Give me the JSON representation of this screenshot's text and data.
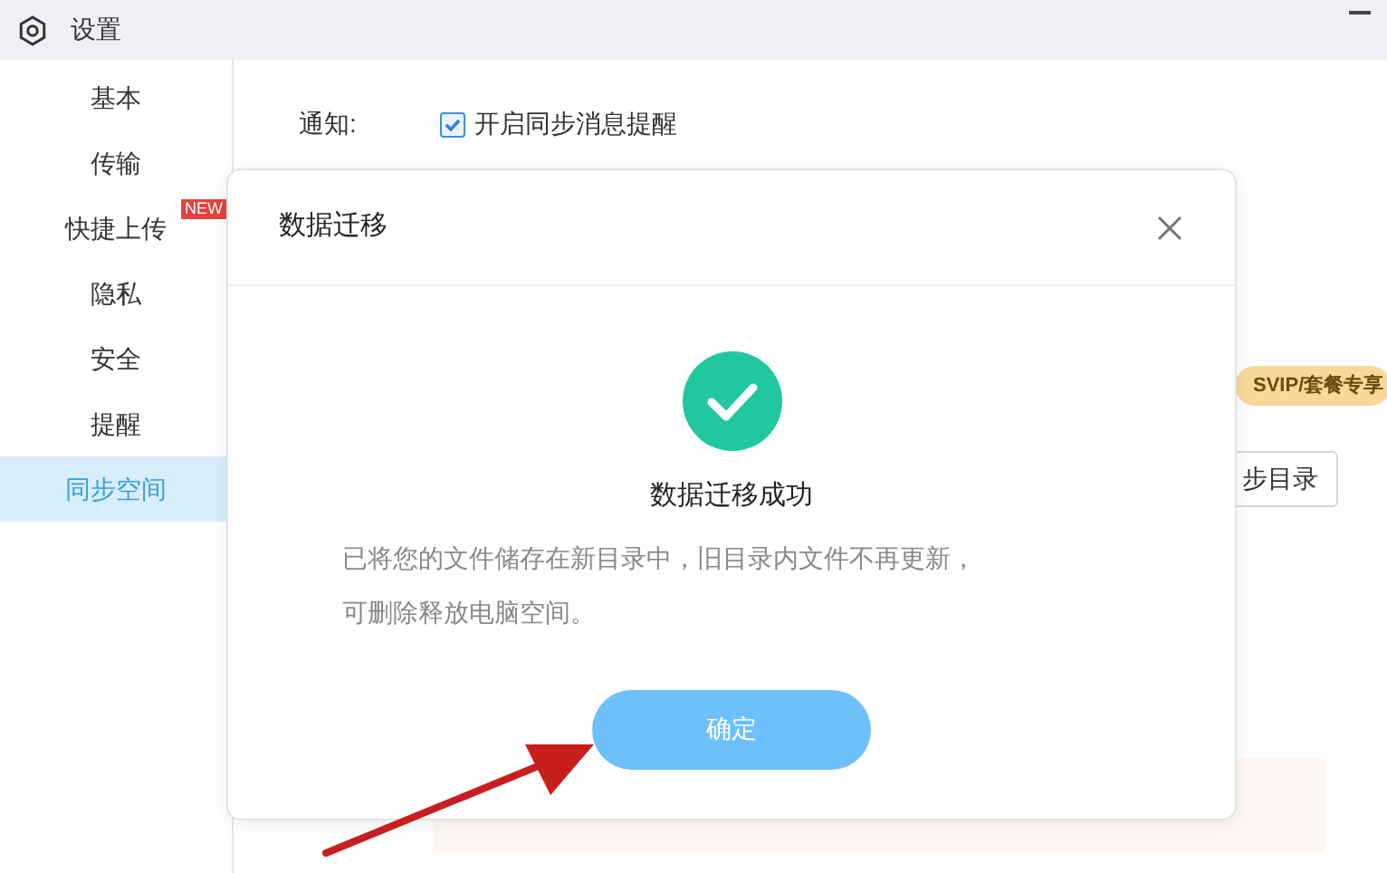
{
  "window": {
    "title": "设置"
  },
  "sidebar": {
    "items": [
      {
        "label": "基本",
        "selected": false
      },
      {
        "label": "传输",
        "selected": false
      },
      {
        "label": "快捷上传",
        "selected": false,
        "badge": "NEW"
      },
      {
        "label": "隐私",
        "selected": false
      },
      {
        "label": "安全",
        "selected": false
      },
      {
        "label": "提醒",
        "selected": false
      },
      {
        "label": "同步空间",
        "selected": true
      }
    ]
  },
  "notification": {
    "label": "通知:",
    "option": "开启同步消息提醒",
    "checked": true
  },
  "svip_badge": "SVIP/套餐专享",
  "partial_button": "步目录",
  "dialog": {
    "title": "数据迁移",
    "heading": "数据迁移成功",
    "message": [
      "已将您的文件储存在新目录中，旧目录内文件不再更新，",
      "可删除释放电脑空间。"
    ],
    "confirm": "确定"
  }
}
